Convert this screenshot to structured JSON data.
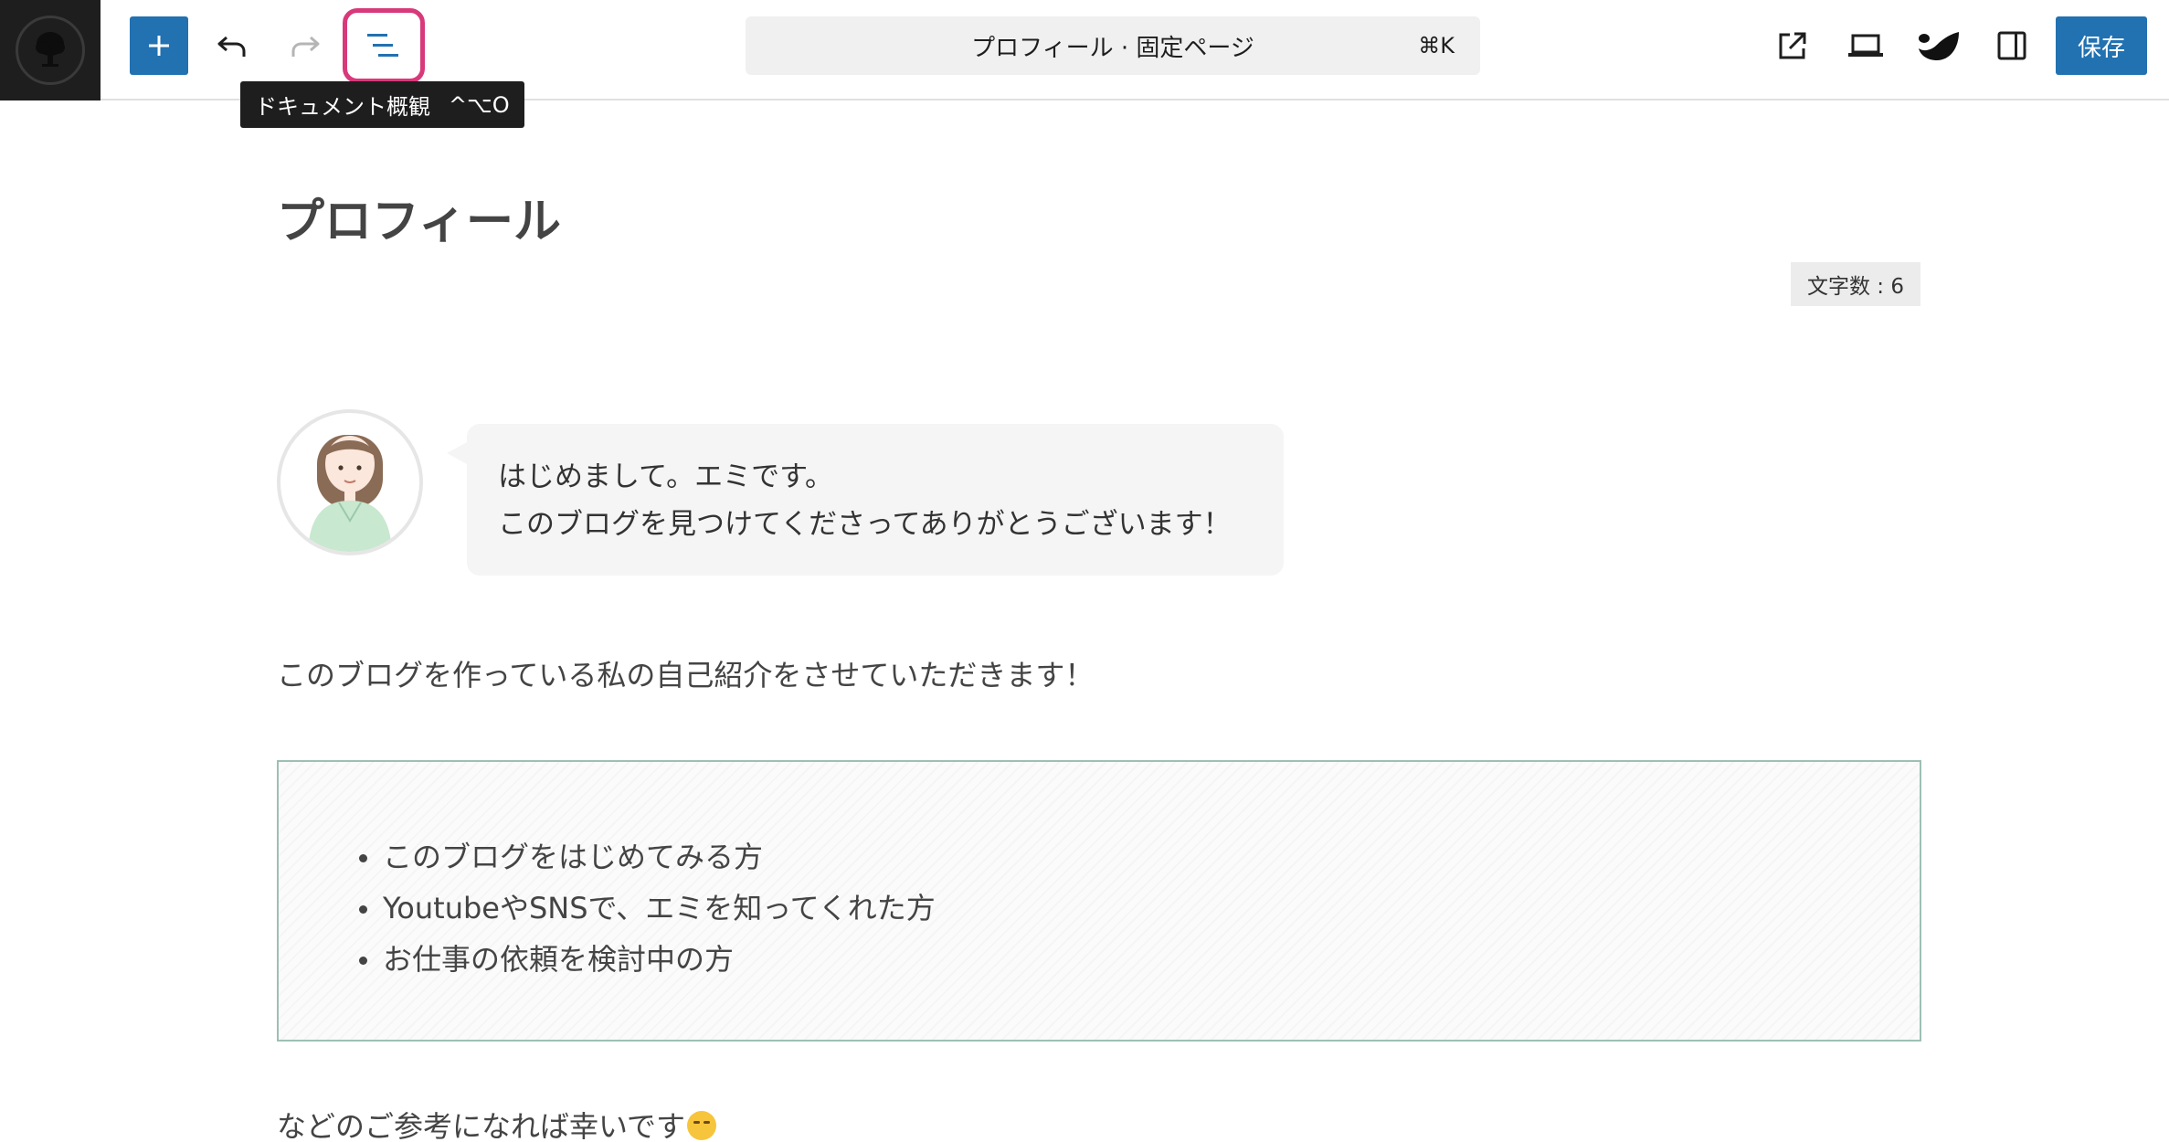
{
  "toolbar": {
    "tooltip": {
      "label": "ドキュメント概観",
      "shortcut": "^⌥O"
    },
    "command": {
      "title": "プロフィール · 固定ページ",
      "shortcut": "⌘K"
    },
    "save_label": "保存",
    "accent_color": "#2271b1",
    "highlight_color": "#d8397a",
    "icons": {
      "inserter": "plus-icon",
      "undo": "undo-icon",
      "redo": "redo-icon",
      "outline": "list-view-icon",
      "view": "external-view-icon",
      "device": "laptop-icon",
      "styles": "styles-icon",
      "settings": "sidebar-settings-icon"
    }
  },
  "editor": {
    "page_title": "プロフィール",
    "word_count": "文字数 : 6",
    "speech": {
      "line1": "はじめまして。エミです。",
      "line2": "このブログを見つけてくださってありがとうございます！"
    },
    "intro": "このブログを作っている私の自己紹介をさせていただきます！",
    "list_items": [
      "このブログをはじめてみる方",
      "YoutubeやSNSで、エミを知ってくれた方",
      "お仕事の依頼を検討中の方"
    ],
    "outro": "などのご参考になれば幸いです"
  }
}
